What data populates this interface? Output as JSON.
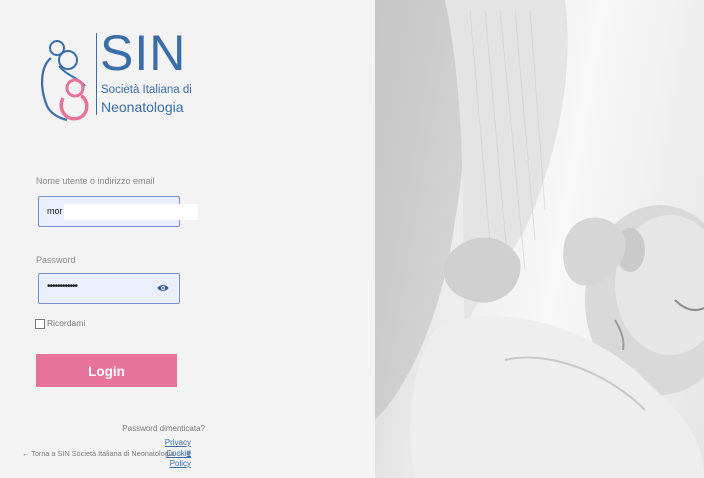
{
  "logo": {
    "title": "SIN",
    "subtitle_line1": "Società Italiana di",
    "subtitle_line2": "Neonatologia"
  },
  "login_form": {
    "username_label": "Nome utente o indirizzo email",
    "username_value": "mor",
    "password_label": "Password",
    "password_value": "••••••••••••",
    "remember_label": "Ricordami",
    "login_button": "Login"
  },
  "footer": {
    "forgot_password": "Password dimenticata?",
    "privacy_link": "Privacy e",
    "back_link": "← Torna a SIN Società Italiana di Neonatologia",
    "cookie_link_1": "Cookie",
    "cookie_link_2": "Policy"
  },
  "colors": {
    "brand_blue": "#3a6ea8",
    "brand_pink": "#e8739a",
    "input_bg": "#e9effd"
  },
  "icons": {
    "password_toggle": "eye-icon",
    "remember_checkbox": "checkbox-icon"
  }
}
